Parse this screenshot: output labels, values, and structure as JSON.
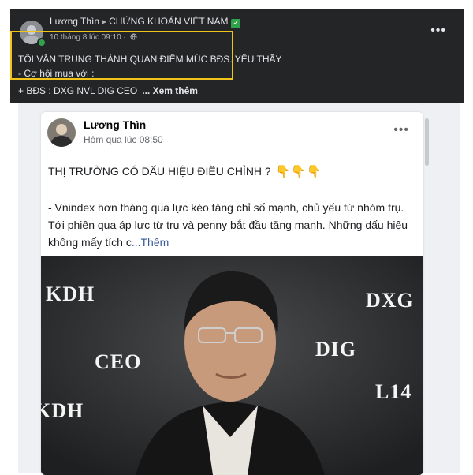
{
  "outer_post": {
    "author": "Lương Thìn",
    "arrow": "▸",
    "group": "CHỨNG KHOÁN VIỆT NAM",
    "verified_mark": "✓",
    "timestamp": "10 tháng 8 lúc 09:10 ·",
    "audience_icon": "globe-icon",
    "line1": "TÔI VẪN TRUNG THÀNH QUAN ĐIỂM MÚC BĐS. YÊU THẦY",
    "line2": "- Cơ hội mua với :",
    "line3": "+ BĐS : DXG NVL DIG CEO",
    "see_more": "... Xem thêm",
    "more_menu": "•••"
  },
  "shared_post": {
    "author": "Lương Thìn",
    "timestamp": "Hôm qua lúc 08:50",
    "more_menu": "•••",
    "headline": "THỊ TRƯỜNG CÓ DẤU HIỆU ĐIỀU CHỈNH ?",
    "headline_emoji": "👇👇👇",
    "body": "- Vnindex hơn tháng qua lực kéo tăng chỉ số mạnh, chủ yếu từ nhóm trụ. Tới phiên qua áp lực từ trụ và penny bắt đầu tăng mạnh. Những dấu hiệu không mấy tích c",
    "see_more": "...Thêm",
    "photo_labels": {
      "kdh_top": "KDH",
      "dxg": "DXG",
      "ceo": "CEO",
      "dig": "DIG",
      "l14": "L14",
      "kdh_bottom": "KDH"
    }
  },
  "colors": {
    "dark_bg": "#242526",
    "highlight_border": "#f0c419",
    "verified": "#31a24c",
    "link": "#385898"
  }
}
